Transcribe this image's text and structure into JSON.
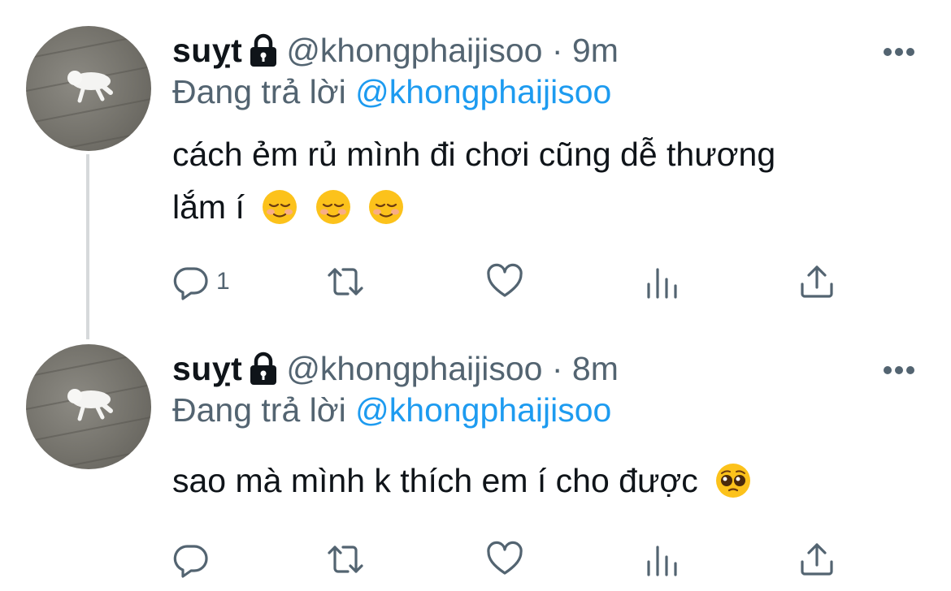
{
  "tweets": [
    {
      "display_name": "suỵt",
      "handle_meta": "@khongphaijisoo · 9m",
      "reply_prefix": "Đang trả lời",
      "reply_to": "@khongphaijisoo",
      "text_lines": [
        "cách ẻm rủ mình đi chơi cũng dễ thương",
        "lắm í"
      ],
      "emojis": [
        "smiling-face-icon",
        "smiling-face-icon",
        "smiling-face-icon"
      ],
      "reply_count": "1"
    },
    {
      "display_name": "suỵt",
      "handle_meta": "@khongphaijisoo · 8m",
      "reply_prefix": "Đang trả lời",
      "reply_to": "@khongphaijisoo",
      "text_lines": [
        "sao mà mình k thích em í cho được"
      ],
      "emojis": [
        "pleading-face-icon"
      ],
      "reply_count": ""
    }
  ],
  "colors": {
    "text": "#0f1419",
    "muted": "#536471",
    "link": "#1d9bf0",
    "thread_line": "#d6d9db"
  },
  "icons": [
    "lock-icon",
    "more-icon",
    "reply-icon",
    "retweet-icon",
    "like-icon",
    "views-icon",
    "share-icon"
  ]
}
